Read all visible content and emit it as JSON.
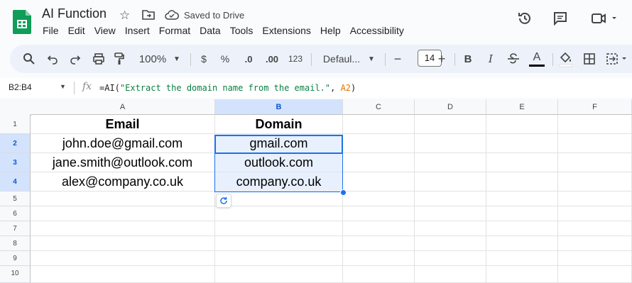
{
  "app": {
    "doc_title": "AI Function",
    "saved_status": "Saved to Drive",
    "menu": [
      "File",
      "Edit",
      "View",
      "Insert",
      "Format",
      "Data",
      "Tools",
      "Extensions",
      "Help",
      "Accessibility"
    ]
  },
  "toolbar": {
    "zoom": "100%",
    "currency": "$",
    "percent": "%",
    "decrease_decimal": ".0",
    "increase_decimal": ".00",
    "number_format": "123",
    "font": "Defaul...",
    "font_size": "14",
    "minus": "−",
    "plus": "+",
    "bold": "B",
    "italic": "I",
    "text_color": "A"
  },
  "formula_bar": {
    "name_box": "B2:B4",
    "fx": "fx",
    "formula_prefix": "=AI(",
    "formula_string": "\"Extract the domain name from the email.\"",
    "formula_sep": ", ",
    "formula_ref": "A2",
    "formula_suffix": ")"
  },
  "sheet": {
    "columns": [
      "A",
      "B",
      "C",
      "D",
      "E",
      "F"
    ],
    "rows": [
      "1",
      "2",
      "3",
      "4",
      "5",
      "6",
      "7",
      "8",
      "9",
      "10"
    ],
    "selected_column": "B",
    "selected_rows": [
      "2",
      "3",
      "4"
    ],
    "cells": {
      "A1": "Email",
      "B1": "Domain",
      "A2": "john.doe@gmail.com",
      "B2": "gmail.com",
      "A3": "jane.smith@outlook.com",
      "B3": "outlook.com",
      "A4": "alex@company.co.uk",
      "B4": "company.co.uk"
    }
  },
  "colors": {
    "accent": "#1a73e8",
    "selection_fill": "#e8f0fe",
    "header_selected": "#d3e3fd",
    "sheets_green": "#0f9d58"
  }
}
